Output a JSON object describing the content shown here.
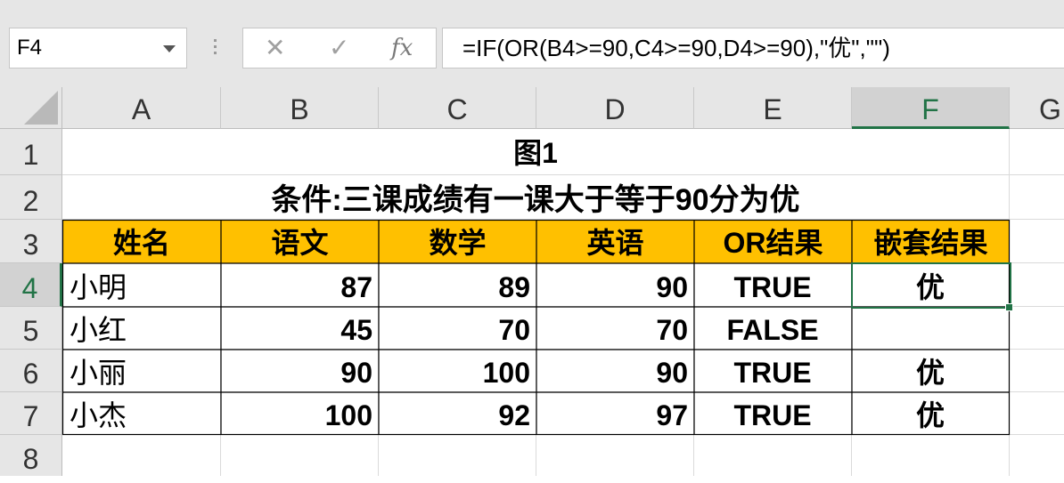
{
  "name_box": "F4",
  "formula_bar": {
    "cancel_icon": "x-icon",
    "enter_icon": "check-icon",
    "fx_label": "fx",
    "formula": "=IF(OR(B4>=90,C4>=90,D4>=90),\"优\",\"\")"
  },
  "columns": [
    "A",
    "B",
    "C",
    "D",
    "E",
    "F",
    "G"
  ],
  "rows": [
    "1",
    "2",
    "3",
    "4",
    "5",
    "6",
    "7",
    "8"
  ],
  "selected_cell": "F4",
  "title": "图1",
  "subtitle": "条件:三课成绩有一课大于等于90分为优",
  "header": [
    "姓名",
    "语文",
    "数学",
    "英语",
    "OR结果",
    "嵌套结果"
  ],
  "records": [
    [
      "小明",
      "87",
      "89",
      "90",
      "TRUE",
      "优"
    ],
    [
      "小红",
      "45",
      "70",
      "70",
      "FALSE",
      ""
    ],
    [
      "小丽",
      "90",
      "100",
      "90",
      "TRUE",
      "优"
    ],
    [
      "小杰",
      "100",
      "92",
      "97",
      "TRUE",
      "优"
    ]
  ],
  "colors": {
    "header_fill": "#ffc000",
    "selection": "#217346"
  }
}
